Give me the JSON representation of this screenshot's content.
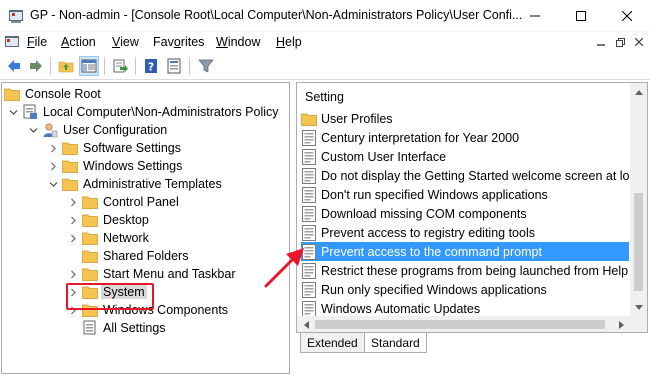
{
  "window": {
    "title": "GP - Non-admin - [Console Root\\Local Computer\\Non-Administrators Policy\\User Confi...",
    "min_glyph": "—",
    "max_glyph": "☐",
    "close_glyph": "✕"
  },
  "menu": {
    "items": [
      {
        "accel": "F",
        "rest": "ile"
      },
      {
        "accel": "A",
        "rest": "ction"
      },
      {
        "accel": "V",
        "rest": "iew"
      },
      {
        "pre": "Fav",
        "accel": "o",
        "rest": "rites"
      },
      {
        "accel": "W",
        "rest": "indow"
      },
      {
        "accel": "H",
        "rest": "elp"
      }
    ]
  },
  "toolbar": {
    "icons": [
      "back-arrow-icon",
      "forward-arrow-icon",
      "up-folder-icon",
      "show-hide-tree-icon",
      "export-list-icon",
      "help-icon",
      "properties-icon",
      "filter-icon"
    ]
  },
  "tree": {
    "nodes": [
      {
        "label": "Console Root",
        "icon": "folder-icon",
        "expander": "none"
      },
      {
        "label": "Local Computer\\Non-Administrators Policy",
        "icon": "policy-icon",
        "expander": "expanded"
      },
      {
        "label": "User Configuration",
        "icon": "user-config-icon",
        "expander": "expanded"
      },
      {
        "label": "Software Settings",
        "icon": "folder-icon",
        "expander": "collapsed"
      },
      {
        "label": "Windows Settings",
        "icon": "folder-icon",
        "expander": "collapsed"
      },
      {
        "label": "Administrative Templates",
        "icon": "folder-icon",
        "expander": "expanded"
      },
      {
        "label": "Control Panel",
        "icon": "folder-icon",
        "expander": "collapsed"
      },
      {
        "label": "Desktop",
        "icon": "folder-icon",
        "expander": "collapsed"
      },
      {
        "label": "Network",
        "icon": "folder-icon",
        "expander": "collapsed"
      },
      {
        "label": "Shared Folders",
        "icon": "folder-icon",
        "expander": "none"
      },
      {
        "label": "Start Menu and Taskbar",
        "icon": "folder-icon",
        "expander": "collapsed"
      },
      {
        "label": "System",
        "icon": "folder-icon",
        "expander": "collapsed",
        "selected": true
      },
      {
        "label": "Windows Components",
        "icon": "folder-icon",
        "expander": "collapsed"
      },
      {
        "label": "All Settings",
        "icon": "all-settings-icon",
        "expander": "none"
      }
    ]
  },
  "list": {
    "header": "Setting",
    "rows": [
      {
        "label": "User Profiles",
        "icon": "folder-icon"
      },
      {
        "label": "Century interpretation for Year 2000",
        "icon": "policy-setting-icon"
      },
      {
        "label": "Custom User Interface",
        "icon": "policy-setting-icon"
      },
      {
        "label": "Do not display the Getting Started welcome screen at logon",
        "icon": "policy-setting-icon"
      },
      {
        "label": "Don't run specified Windows applications",
        "icon": "policy-setting-icon"
      },
      {
        "label": "Download missing COM components",
        "icon": "policy-setting-icon"
      },
      {
        "label": "Prevent access to registry editing tools",
        "icon": "policy-setting-icon"
      },
      {
        "label": "Prevent access to the command prompt",
        "icon": "policy-setting-icon",
        "selected": true
      },
      {
        "label": "Restrict these programs from being launched from Help",
        "icon": "policy-setting-icon"
      },
      {
        "label": "Run only specified Windows applications",
        "icon": "policy-setting-icon"
      },
      {
        "label": "Windows Automatic Updates",
        "icon": "policy-setting-icon"
      }
    ]
  },
  "tabs": {
    "extended": "Extended",
    "standard": "Standard"
  },
  "colors": {
    "selection": "#3399ff",
    "annotation_red": "#e8182c",
    "folder": "#f5c350"
  }
}
